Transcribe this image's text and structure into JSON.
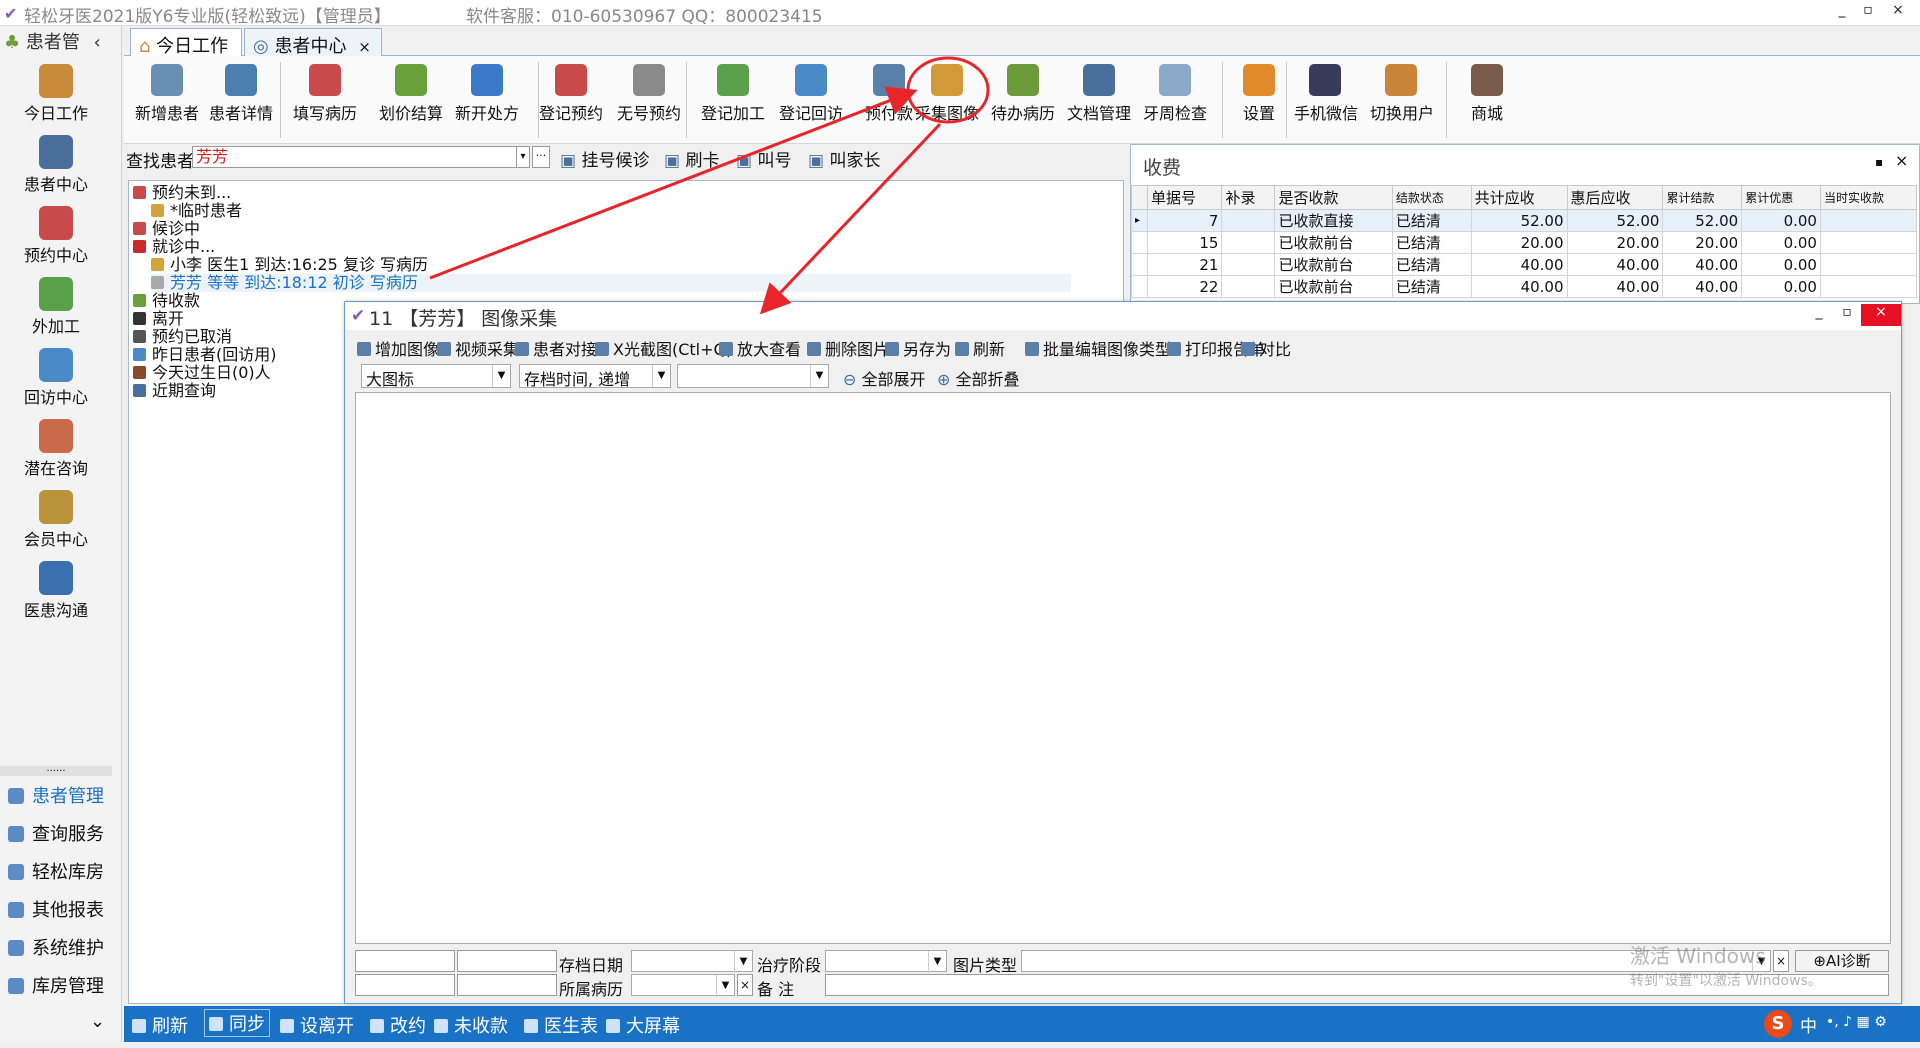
{
  "window": {
    "title": "轻松牙医2021版Y6专业版(轻松致远)【管理员】",
    "support": "软件客服：010-60530967  QQ：800023415",
    "controls": [
      "_",
      "▫",
      "×"
    ]
  },
  "sidebar": {
    "header": "患者管",
    "collapse": "‹",
    "nav": [
      {
        "label": "今日工作",
        "icon": "doctor-icon",
        "color": "#c98a3a"
      },
      {
        "label": "患者中心",
        "icon": "binoculars-icon",
        "color": "#4a6f9a"
      },
      {
        "label": "预约中心",
        "icon": "calendar-icon",
        "color": "#c94a4a"
      },
      {
        "label": "外加工",
        "icon": "cubes-icon",
        "color": "#5aa04a"
      },
      {
        "label": "回访中心",
        "icon": "refresh-icon",
        "color": "#4a8ac9"
      },
      {
        "label": "潜在咨询",
        "icon": "consult-icon",
        "color": "#c96a4a"
      },
      {
        "label": "会员中心",
        "icon": "members-icon",
        "color": "#b9943a"
      },
      {
        "label": "医患沟通",
        "icon": "film-icon",
        "color": "#3a6fb0"
      }
    ],
    "dots": "......",
    "modules": [
      "患者管理",
      "查询服务",
      "轻松库房",
      "其他报表",
      "系统维护",
      "库房管理"
    ],
    "more": "⌄"
  },
  "tabs": [
    {
      "label": "今日工作",
      "active": true
    },
    {
      "label": "患者中心",
      "active": false,
      "close": "×"
    }
  ],
  "ribbon": [
    {
      "label": "新增患者",
      "color": "#6a8fb5"
    },
    {
      "label": "患者详情",
      "color": "#4a7fb0"
    },
    {
      "label": "填写病历",
      "color": "#c94a4a"
    },
    {
      "label": "划价结算",
      "color": "#6aa03a"
    },
    {
      "label": "新开处方",
      "color": "#3a7ac9"
    },
    {
      "label": "登记预约",
      "color": "#c94a4a"
    },
    {
      "label": "无号预约",
      "color": "#8a8a8a"
    },
    {
      "label": "登记加工",
      "color": "#5aa04a"
    },
    {
      "label": "登记回访",
      "color": "#4a8ac9"
    },
    {
      "label": "预付款",
      "color": "#5a7fa8"
    },
    {
      "label": "采集图像",
      "color": "#d09a3a"
    },
    {
      "label": "待办病历",
      "color": "#6a9a3a"
    },
    {
      "label": "文档管理",
      "color": "#4a6f9a"
    },
    {
      "label": "牙周检查",
      "color": "#8aa8c8"
    },
    {
      "label": "设置",
      "color": "#e08a2a"
    },
    {
      "label": "手机微信",
      "color": "#3a3a5a"
    },
    {
      "label": "切换用户",
      "color": "#c9843a"
    },
    {
      "label": "商城",
      "color": "#7a5a4a"
    }
  ],
  "find": {
    "label": "查找患者",
    "value": "芳芳",
    "more": "···",
    "actions": [
      "挂号候诊",
      "刷卡",
      "叫号",
      "叫家长"
    ]
  },
  "patients": [
    {
      "text": "预约未到...",
      "indent": 0,
      "color": "#c94a4a"
    },
    {
      "text": "*临时患者",
      "indent": 1,
      "color": "#d4a43a"
    },
    {
      "text": "候诊中",
      "indent": 0,
      "color": "#c94a4a"
    },
    {
      "text": "就诊中...",
      "indent": 0,
      "color": "#c92a2a"
    },
    {
      "text": "小李   医生1 到达:16:25 复诊  写病历",
      "indent": 1,
      "color": "#d4a43a"
    },
    {
      "text": "芳芳   等等  到达:18:12 初诊  写病历",
      "indent": 1,
      "color": "#a8a8a8",
      "highlight": true
    },
    {
      "text": "待收款",
      "indent": 0,
      "color": "#6aa03a"
    },
    {
      "text": "离开",
      "indent": 0,
      "color": "#333333"
    },
    {
      "text": "预约已取消",
      "indent": 0,
      "color": "#555555"
    },
    {
      "text": "昨日患者(回访用)",
      "indent": 0,
      "color": "#4a8ac9"
    },
    {
      "text": "今天过生日(0)人",
      "indent": 0,
      "color": "#8a4a2a"
    },
    {
      "text": "近期查询",
      "indent": 0,
      "color": "#4a6f9a"
    }
  ],
  "fees": {
    "title": "收费",
    "pin": "▪",
    "close": "×",
    "columns": [
      "单据号",
      "补录",
      "是否收款",
      "结款状态",
      "共计应收",
      "惠后应收",
      "累计结款",
      "累计优惠",
      "当时实收款"
    ],
    "rows": [
      [
        "7",
        "",
        "已收款直接",
        "已结清",
        "52.00",
        "52.00",
        "52.00",
        "0.00",
        ""
      ],
      [
        "15",
        "",
        "已收款前台",
        "已结清",
        "20.00",
        "20.00",
        "20.00",
        "0.00",
        ""
      ],
      [
        "21",
        "",
        "已收款前台",
        "已结清",
        "40.00",
        "40.00",
        "40.00",
        "0.00",
        ""
      ],
      [
        "22",
        "",
        "已收款前台",
        "已结清",
        "40.00",
        "40.00",
        "40.00",
        "0.00",
        ""
      ]
    ]
  },
  "image_window": {
    "title": "11   【芳芳】  图像采集",
    "controls": [
      "_",
      "▫",
      "×"
    ],
    "toolbar": [
      "增加图像",
      "视频采集",
      "患者对接",
      "X光截图(Ctl+Q)",
      "放大查看",
      "删除图片",
      "另存为",
      "刷新",
      "批量编辑图像类型",
      "打印报告单",
      "对比"
    ],
    "view_select": "大图标",
    "sort_select": "存档时间, 递增",
    "filter_select": "",
    "expand_all": "全部展开",
    "collapse_all": "全部折叠",
    "form": {
      "date_label": "存档日期",
      "stage_label": "治疗阶段",
      "type_label": "图片类型",
      "record_label": "所属病历",
      "note_label": "备    注",
      "ai_button": "AI诊断"
    }
  },
  "watermark": {
    "line1": "激活 Windows",
    "line2": "转到\"设置\"以激活 Windows。"
  },
  "statusbar": [
    "刷新",
    "同步",
    "设离开",
    "改约",
    "未收款",
    "医生表",
    "大屏幕"
  ],
  "tray": {
    "ime": "中",
    "logo": "S"
  },
  "accent": "#1a72c6",
  "annotation_color": "#e8252a"
}
